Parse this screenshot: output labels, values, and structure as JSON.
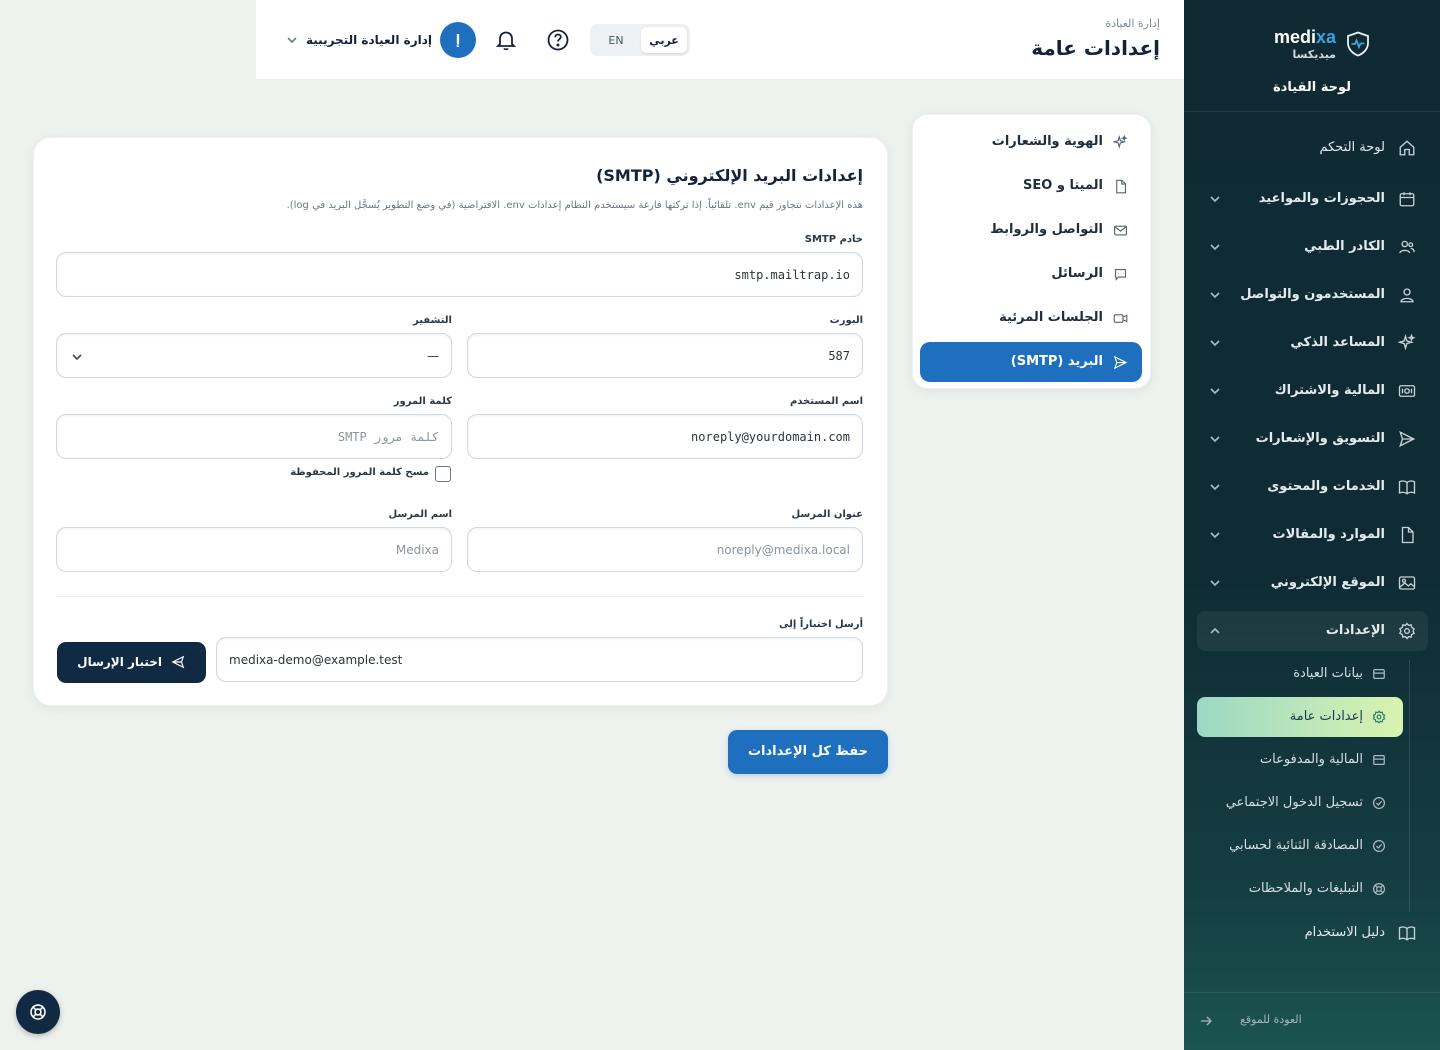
{
  "brand": {
    "name_en_main": "medi",
    "name_en_accent": "xa",
    "name_ar": "ميديكسا",
    "subtitle": "لوحة القيادة"
  },
  "sidebar": {
    "items": [
      {
        "label": "لوحة التحكم",
        "icon": "home-icon"
      },
      {
        "label": "الحجوزات والمواعيد",
        "icon": "calendar-icon"
      },
      {
        "label": "الكادر الطبي",
        "icon": "users-icon"
      },
      {
        "label": "المستخدمون والتواصل",
        "icon": "user-icon"
      },
      {
        "label": "المساعد الذكي",
        "icon": "sparkles-icon"
      },
      {
        "label": "المالية والاشتراك",
        "icon": "money-icon"
      },
      {
        "label": "التسويق والإشعارات",
        "icon": "send-icon"
      },
      {
        "label": "الخدمات والمحتوى",
        "icon": "book-icon"
      },
      {
        "label": "الموارد والمقالات",
        "icon": "file-icon"
      },
      {
        "label": "الموقع الإلكتروني",
        "icon": "image-icon"
      },
      {
        "label": "الإعدادات",
        "icon": "gear-icon"
      }
    ],
    "settings_sub": [
      {
        "label": "بيانات العيادة",
        "icon": "box-icon"
      },
      {
        "label": "إعدادات عامة",
        "icon": "gear-icon"
      },
      {
        "label": "المالية والمدفوعات",
        "icon": "box-icon"
      },
      {
        "label": "تسجيل الدخول الاجتماعي",
        "icon": "check-circle-icon"
      },
      {
        "label": "المصادقة الثنائية لحسابي",
        "icon": "check-circle-icon"
      },
      {
        "label": "التبليغات والملاحظات",
        "icon": "lifebuoy-icon"
      }
    ],
    "guide": "دليل الاستخدام",
    "back": "العودة للموقع"
  },
  "header": {
    "breadcrumb": "إدارة العيادة",
    "title": "إعدادات عامة",
    "lang_ar": "عربي",
    "lang_en": "EN",
    "user_initial": "إ",
    "user_name": "إدارة العيادة التجريبية"
  },
  "subnav": [
    {
      "label": "الهوية والشعارات",
      "icon": "sparkles-icon"
    },
    {
      "label": "الميتا و SEO",
      "icon": "file-icon"
    },
    {
      "label": "التواصل والروابط",
      "icon": "mail-icon"
    },
    {
      "label": "الرسائل",
      "icon": "chat-icon"
    },
    {
      "label": "الجلسات المرئية",
      "icon": "video-icon"
    },
    {
      "label": "البريد (SMTP)",
      "icon": "send-icon"
    }
  ],
  "smtp": {
    "title": "إعدادات البريد الإلكتروني (SMTP)",
    "description": "هذه الإعدادات تتجاوز قيم env. تلقائياً. إذا تركتها فارغة سيستخدم النظام إعدادات env. الافتراضية (في وضع التطوير يُسجَّل البريد في log).",
    "host_label": "خادم SMTP",
    "host_value": "smtp.mailtrap.io",
    "port_label": "البورت",
    "port_value": "587",
    "encryption_label": "التشفير",
    "encryption_value": "—",
    "username_label": "اسم المستخدم",
    "username_value": "noreply@yourdomain.com",
    "password_label": "كلمة المرور",
    "password_placeholder": "كلمة مرور SMTP",
    "clear_password_label": "مسح كلمة المرور المحفوظة",
    "from_address_label": "عنوان المرسل",
    "from_address_value": "noreply@medixa.local",
    "from_name_label": "اسم المرسل",
    "from_name_value": "Medixa",
    "test_label": "أرسل اختباراً إلى",
    "test_value": "medixa-demo@example.test",
    "test_button": "اختبار الإرسال"
  },
  "save_button": "حفظ كل الإعدادات",
  "colors": {
    "primary": "#1e70bf",
    "sidebar": "#0f2a33",
    "dark_button": "#102a43",
    "active_sub_start": "#d9f3b0",
    "active_sub_end": "#9bd8c5"
  }
}
